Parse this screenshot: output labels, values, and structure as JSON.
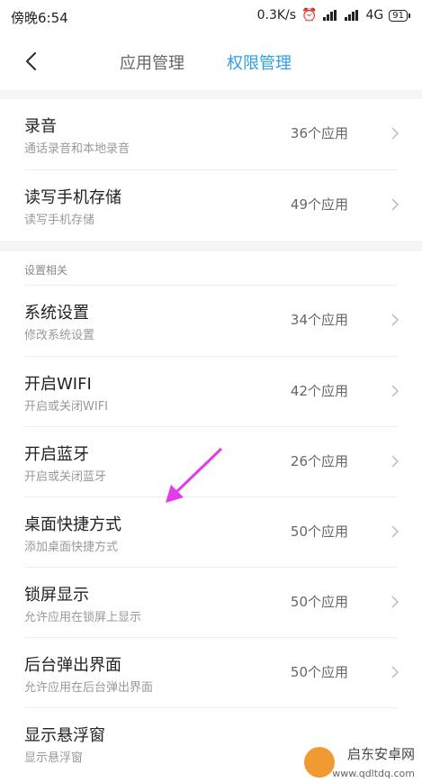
{
  "status": {
    "time": "傍晚6:54",
    "speed": "0.3K/s",
    "network": "4G",
    "battery": "91"
  },
  "header": {
    "tab_apps": "应用管理",
    "tab_permissions": "权限管理"
  },
  "sections": {
    "group_label": "设置相关"
  },
  "rows": [
    {
      "title": "录音",
      "subtitle": "通话录音和本地录音",
      "count": "36个应用"
    },
    {
      "title": "读写手机存储",
      "subtitle": "读写手机存储",
      "count": "49个应用"
    },
    {
      "title": "系统设置",
      "subtitle": "修改系统设置",
      "count": "34个应用"
    },
    {
      "title": "开启WIFI",
      "subtitle": "开启或关闭WIFI",
      "count": "42个应用"
    },
    {
      "title": "开启蓝牙",
      "subtitle": "开启或关闭蓝牙",
      "count": "26个应用"
    },
    {
      "title": "桌面快捷方式",
      "subtitle": "添加桌面快捷方式",
      "count": "50个应用"
    },
    {
      "title": "锁屏显示",
      "subtitle": "允许应用在锁屏上显示",
      "count": "50个应用"
    },
    {
      "title": "后台弹出界面",
      "subtitle": "允许应用在后台弹出界面",
      "count": "50个应用"
    },
    {
      "title": "显示悬浮窗",
      "subtitle": "显示悬浮窗",
      "count": ""
    }
  ],
  "watermark": {
    "text": "启东安卓网",
    "url": "www.qdltdq.com"
  },
  "colors": {
    "accent": "#2aa0e8",
    "arrow": "#e23be8"
  }
}
